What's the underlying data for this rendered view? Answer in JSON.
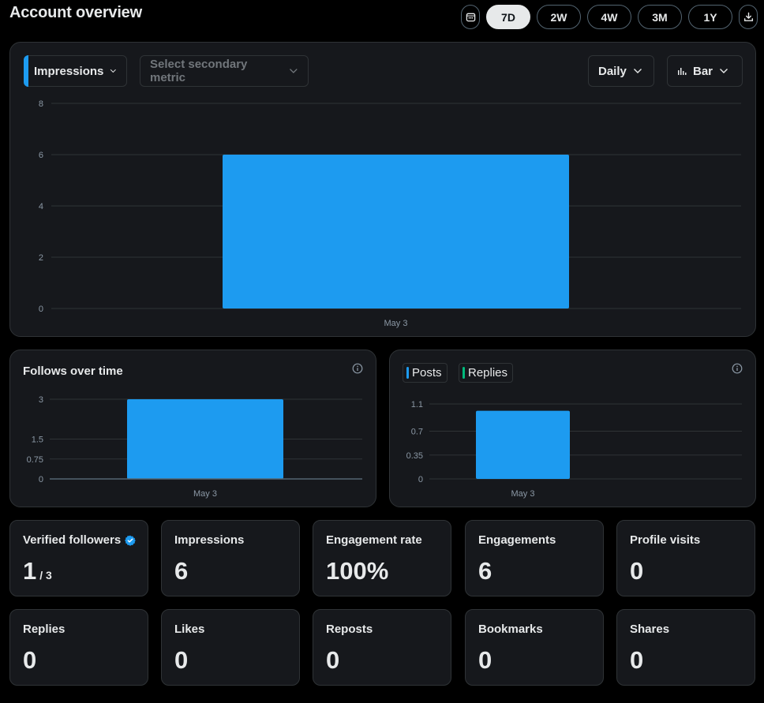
{
  "page": {
    "title": "Account overview"
  },
  "range_buttons": [
    {
      "label": "7D",
      "active": true
    },
    {
      "label": "2W",
      "active": false
    },
    {
      "label": "4W",
      "active": false
    },
    {
      "label": "3M",
      "active": false
    },
    {
      "label": "1Y",
      "active": false
    }
  ],
  "main_card": {
    "primary_metric": "Impressions",
    "secondary_metric_placeholder": "Select secondary metric",
    "interval": "Daily",
    "chart_type": "Bar"
  },
  "follows_card": {
    "title": "Follows over time"
  },
  "posts_card": {
    "legend": [
      "Posts",
      "Replies"
    ]
  },
  "colors": {
    "accent": "#1d9bf0",
    "replies": "#00ba7c",
    "card_bg": "#16181c",
    "border": "#2f3336"
  },
  "stats": [
    {
      "label": "Verified followers",
      "value": "1",
      "sub": "/ 3",
      "verified": true
    },
    {
      "label": "Impressions",
      "value": "6"
    },
    {
      "label": "Engagement rate",
      "value": "100%"
    },
    {
      "label": "Engagements",
      "value": "6"
    },
    {
      "label": "Profile visits",
      "value": "0"
    },
    {
      "label": "Replies",
      "value": "0"
    },
    {
      "label": "Likes",
      "value": "0"
    },
    {
      "label": "Reposts",
      "value": "0"
    },
    {
      "label": "Bookmarks",
      "value": "0"
    },
    {
      "label": "Shares",
      "value": "0"
    }
  ],
  "chart_data": [
    {
      "type": "bar",
      "categories": [
        "May 3"
      ],
      "values": [
        6
      ],
      "ylim": [
        0,
        8
      ],
      "yticks": [
        0,
        2,
        4,
        6,
        8
      ],
      "grid": true
    },
    {
      "type": "bar",
      "title": "Follows over time",
      "categories": [
        "May 3"
      ],
      "values": [
        3
      ],
      "ylim": [
        0,
        3
      ],
      "yticks": [
        0,
        0.75,
        1.5,
        3
      ],
      "grid": true
    },
    {
      "type": "bar",
      "categories": [
        "May 3"
      ],
      "series": [
        {
          "name": "Posts",
          "values": [
            1
          ]
        },
        {
          "name": "Replies",
          "values": [
            0
          ]
        }
      ],
      "ylim": [
        0,
        1.1
      ],
      "yticks": [
        0,
        0.35,
        0.7,
        1.1
      ],
      "grid": true
    }
  ]
}
